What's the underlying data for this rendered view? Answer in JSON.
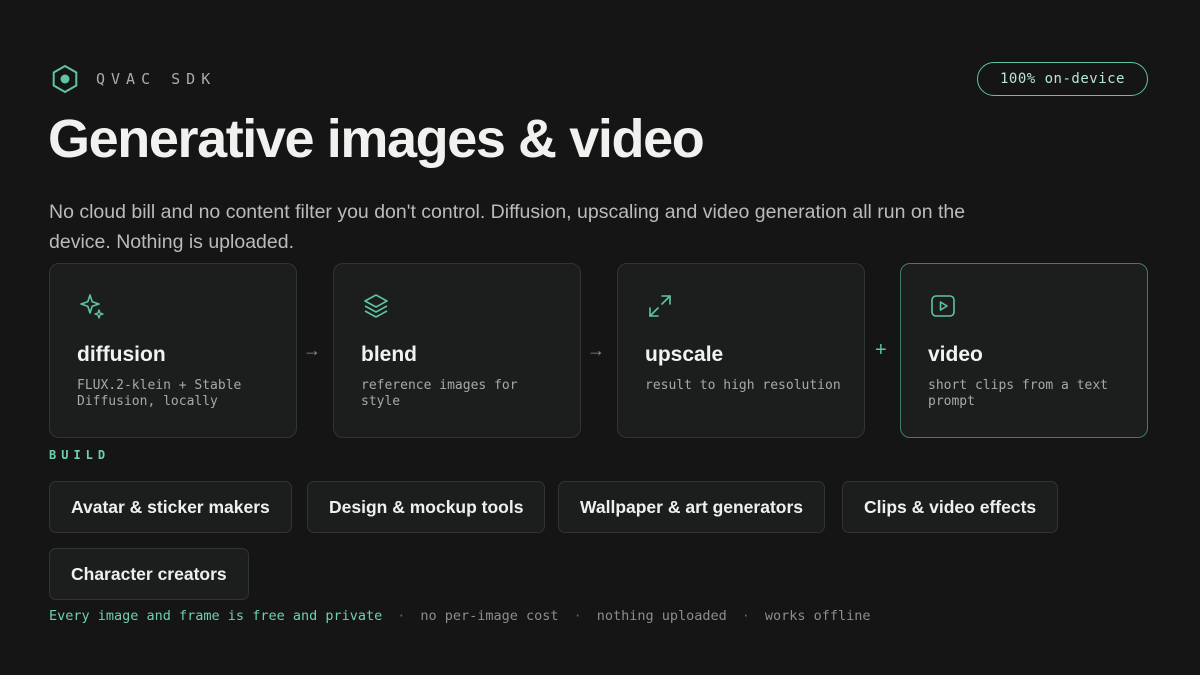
{
  "brand": {
    "name": "QVAC SDK",
    "icon": "hexagon-icon",
    "accent_color": "#5fc4a4"
  },
  "badge": "100% on-device",
  "title": "Generative images & video",
  "subtitle": "No cloud bill and no content filter you don't control. Diffusion, upscaling and video generation all run on the device. Nothing is uploaded.",
  "pipeline": [
    {
      "title": "diffusion",
      "description": "FLUX.2-klein + Stable Diffusion, locally",
      "icon": "sparkle-icon"
    },
    {
      "title": "blend",
      "description": "reference images for style",
      "icon": "layers-icon"
    },
    {
      "title": "upscale",
      "description": "result to high resolution",
      "icon": "expand-icon"
    },
    {
      "title": "video",
      "description": "short clips from a text prompt",
      "icon": "play-icon"
    }
  ],
  "connectors": [
    "→",
    "→",
    "+"
  ],
  "build": {
    "label": "BUILD",
    "chips": [
      "Avatar & sticker makers",
      "Design & mockup tools",
      "Wallpaper & art generators",
      "Clips & video effects",
      "Character creators"
    ]
  },
  "footer": {
    "highlight": "Every image and frame is free and private",
    "separator": "·",
    "items": [
      "no per-image cost",
      "nothing uploaded",
      "works offline"
    ]
  }
}
